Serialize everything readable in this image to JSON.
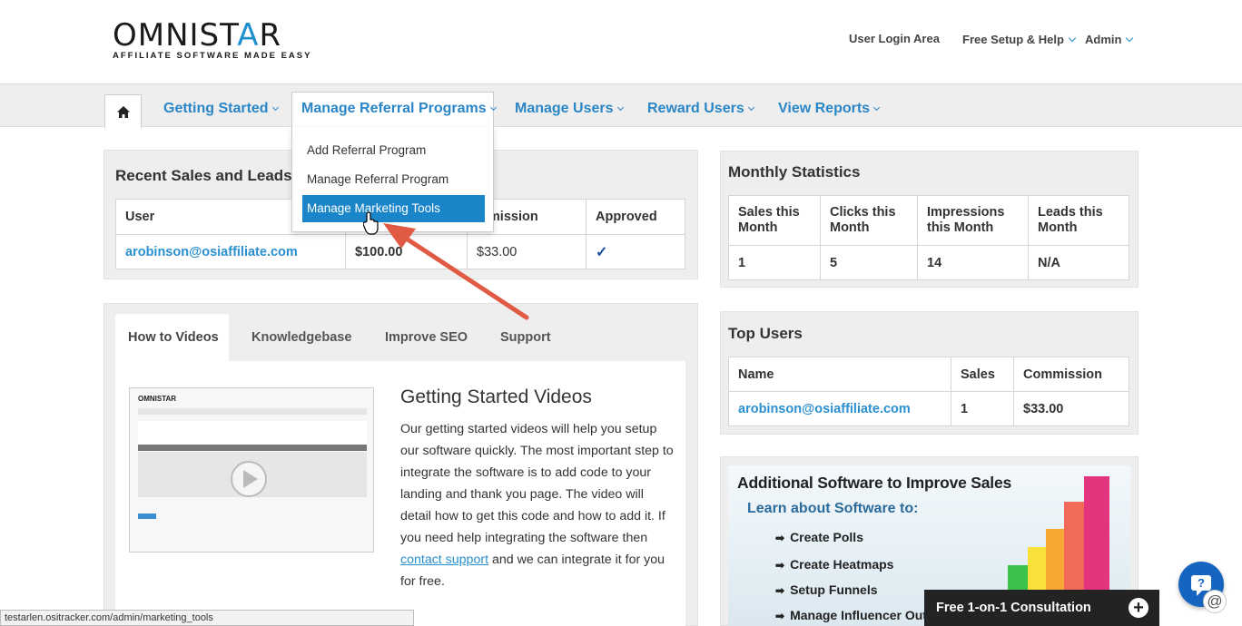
{
  "logo": {
    "word_left": "OMNIST",
    "word_star": "A",
    "word_right": "R",
    "tagline": "AFFILIATE SOFTWARE MADE EASY"
  },
  "toplinks": [
    {
      "label": "User Login Area"
    },
    {
      "label": "Free Setup & Help"
    },
    {
      "label": "Admin"
    }
  ],
  "nav": {
    "items": [
      {
        "label": "Getting Started"
      },
      {
        "label": "Manage Referral Programs"
      },
      {
        "label": "Manage Users"
      },
      {
        "label": "Reward Users"
      },
      {
        "label": "View Reports"
      }
    ],
    "dropdown": [
      {
        "label": "Add Referral Program"
      },
      {
        "label": "Manage Referral Program"
      },
      {
        "label": "Manage Marketing Tools"
      }
    ]
  },
  "recent": {
    "title": "Recent Sales and Leads",
    "headers": [
      "User",
      "",
      "mmission",
      "Approved"
    ],
    "rows": [
      {
        "user": "arobinson@osiaffiliate.com",
        "amount": "$100.00",
        "commission": "$33.00",
        "approved": "✓"
      }
    ]
  },
  "monthly": {
    "title": "Monthly Statistics",
    "headers": [
      "Sales this Month",
      "Clicks this Month",
      "Impressions this Month",
      "Leads this Month"
    ],
    "values": [
      "1",
      "5",
      "14",
      "N/A"
    ]
  },
  "topusers": {
    "title": "Top Users",
    "headers": [
      "Name",
      "Sales",
      "Commission"
    ],
    "rows": [
      {
        "name": "arobinson@osiaffiliate.com",
        "sales": "1",
        "commission": "$33.00"
      }
    ]
  },
  "tabs": [
    {
      "label": "How to Videos"
    },
    {
      "label": "Knowledgebase"
    },
    {
      "label": "Improve SEO"
    },
    {
      "label": "Support"
    }
  ],
  "video_section": {
    "title": "Getting Started Videos",
    "text_before": "Our getting started videos will help you setup our software quickly. The most important step to integrate the software is to add code to your landing and thank you page. The video will detail how to get this code and how to add it. If you need help integrating the software then ",
    "link": "contact support",
    "text_after": " and we can integrate it for you for free."
  },
  "promo": {
    "heading": "Additional Software to Improve Sales",
    "subheading": "Learn about Software to:",
    "items": [
      "Create Polls",
      "Create Heatmaps",
      "Setup Funnels",
      "Manage Influencer Outr"
    ]
  },
  "statusbar": "testarlen.ositracker.com/admin/marketing_tools",
  "consult": {
    "label": "Free 1-on-1 Consultation",
    "plus": "+"
  },
  "chat": {
    "q": "?",
    "at": "@"
  },
  "colors": {
    "accent": "#2a86c7",
    "active": "#1a85c8",
    "arrow": "#e05a44"
  },
  "icons": [
    "home-icon",
    "chevron-down-icon",
    "checkmark-icon",
    "play-icon",
    "chat-icon",
    "plus-icon",
    "cursor-hand-icon"
  ]
}
